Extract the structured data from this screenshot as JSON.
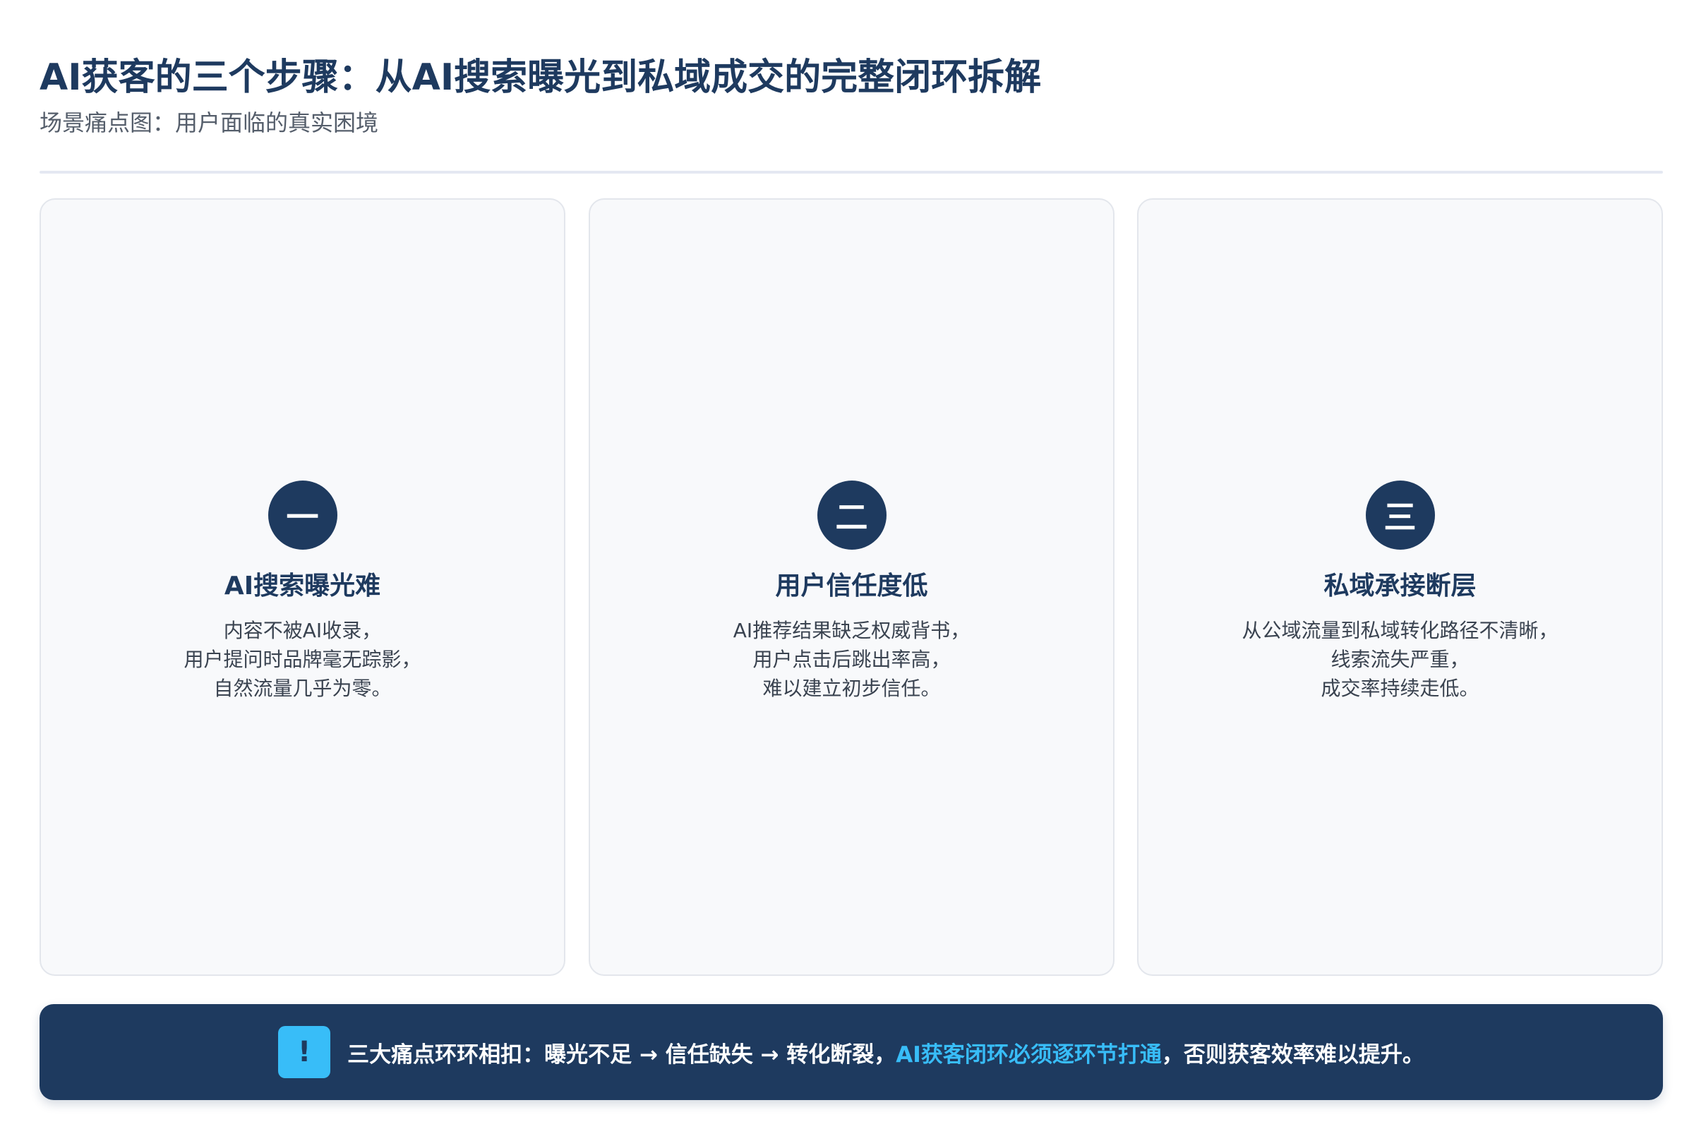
{
  "header": {
    "title": "AI获客的三个步骤：从AI搜索曝光到私域成交的完整闭环拆解",
    "subtitle": "场景痛点图：用户面临的真实困境"
  },
  "cards": [
    {
      "number": "一",
      "title": "AI搜索曝光难",
      "lines": [
        "内容不被AI收录，",
        "用户提问时品牌毫无踪影，",
        "自然流量几乎为零。"
      ]
    },
    {
      "number": "二",
      "title": "用户信任度低",
      "lines": [
        "AI推荐结果缺乏权威背书，",
        "用户点击后跳出率高，",
        "难以建立初步信任。"
      ]
    },
    {
      "number": "三",
      "title": "私域承接断层",
      "lines": [
        "从公域流量到私域转化路径不清晰，",
        "线索流失严重，",
        "成交率持续走低。"
      ]
    }
  ],
  "banner": {
    "icon_name": "exclamation-icon",
    "icon_glyph": "!",
    "text_before": "三大痛点环环相扣：曝光不足 → 信任缺失 → 转化断裂，",
    "text_highlight": "AI获客闭环必须逐环节打通",
    "text_after": "，否则获客效率难以提升。"
  },
  "colors": {
    "primary": "#1e3a5f",
    "accent": "#38bdf8",
    "card_bg": "#f8f9fb"
  }
}
